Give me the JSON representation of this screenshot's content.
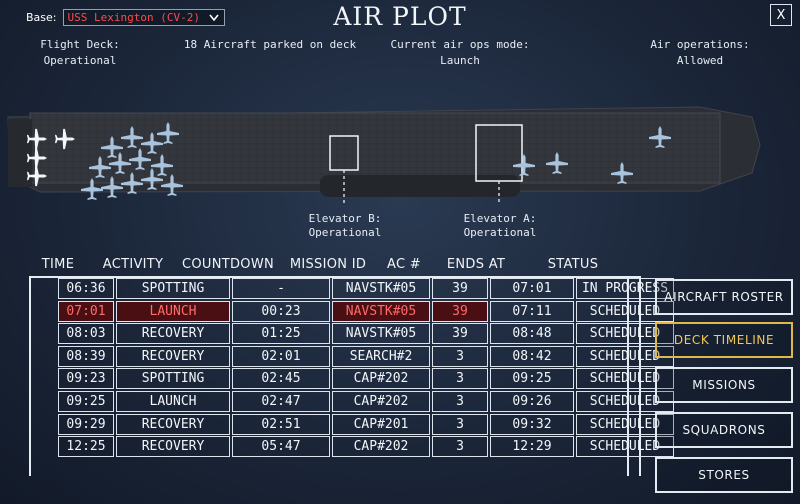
{
  "header": {
    "base_label": "Base:",
    "base_value": "USS Lexington (CV-2)",
    "title": "AIR PLOT",
    "close_label": "X"
  },
  "status": {
    "flight_deck_label": "Flight Deck:",
    "flight_deck_value": "Operational",
    "parked_text": "18 Aircraft parked on deck",
    "ops_mode_label": "Current air ops mode:",
    "ops_mode_value": "Launch",
    "air_ops_label": "Air operations:",
    "air_ops_value": "Allowed"
  },
  "elevators": {
    "b_label": "Elevator B:",
    "b_status": "Operational",
    "a_label": "Elevator A:",
    "a_status": "Operational"
  },
  "table": {
    "headers": [
      "TIME",
      "ACTIVITY",
      "COUNTDOWN",
      "MISSION ID",
      "AC #",
      "ENDS AT",
      "STATUS"
    ],
    "rows": [
      {
        "time": "06:36",
        "activity": "SPOTTING",
        "countdown": "-",
        "mission": "NAVSTK#05",
        "ac": "39",
        "ends": "07:01",
        "status": "IN PROGRESS",
        "selected": false
      },
      {
        "time": "07:01",
        "activity": "LAUNCH",
        "countdown": "00:23",
        "mission": "NAVSTK#05",
        "ac": "39",
        "ends": "07:11",
        "status": "SCHEDULED",
        "selected": true
      },
      {
        "time": "08:03",
        "activity": "RECOVERY",
        "countdown": "01:25",
        "mission": "NAVSTK#05",
        "ac": "39",
        "ends": "08:48",
        "status": "SCHEDULED",
        "selected": false
      },
      {
        "time": "08:39",
        "activity": "RECOVERY",
        "countdown": "02:01",
        "mission": "SEARCH#2",
        "ac": "3",
        "ends": "08:42",
        "status": "SCHEDULED",
        "selected": false
      },
      {
        "time": "09:23",
        "activity": "SPOTTING",
        "countdown": "02:45",
        "mission": "CAP#202",
        "ac": "3",
        "ends": "09:25",
        "status": "SCHEDULED",
        "selected": false
      },
      {
        "time": "09:25",
        "activity": "LAUNCH",
        "countdown": "02:47",
        "mission": "CAP#202",
        "ac": "3",
        "ends": "09:26",
        "status": "SCHEDULED",
        "selected": false
      },
      {
        "time": "09:29",
        "activity": "RECOVERY",
        "countdown": "02:51",
        "mission": "CAP#201",
        "ac": "3",
        "ends": "09:32",
        "status": "SCHEDULED",
        "selected": false
      },
      {
        "time": "12:25",
        "activity": "RECOVERY",
        "countdown": "05:47",
        "mission": "CAP#202",
        "ac": "3",
        "ends": "12:29",
        "status": "SCHEDULED",
        "selected": false
      }
    ]
  },
  "side_buttons": {
    "aircraft_roster": "AIRCRAFT ROSTER",
    "deck_timeline": "DECK TIMELINE",
    "missions": "MISSIONS",
    "squadrons": "SQUADRONS",
    "stores": "STORES",
    "active": "deck_timeline"
  },
  "colors": {
    "selected_text": "#ff6a6a",
    "selected_bg": "#4a0f12",
    "active_button": "#f0c85a",
    "base_value_text": "#ff4a4a"
  },
  "icons": {
    "close": "close-icon",
    "dropdown": "chevron-down-icon",
    "aircraft": "aircraft-icon"
  }
}
